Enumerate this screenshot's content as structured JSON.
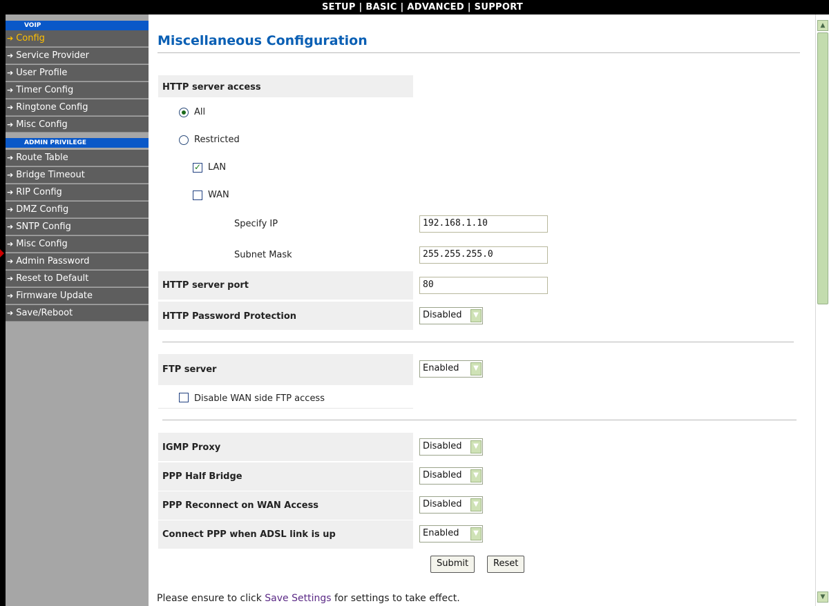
{
  "topnav": {
    "setup": "SETUP",
    "basic": "BASIC",
    "advanced": "ADVANCED",
    "support": "SUPPORT",
    "sep": "|"
  },
  "sidebar": {
    "voip_header": "VOIP",
    "voip_items": [
      {
        "label": "Config"
      },
      {
        "label": "Service Provider"
      },
      {
        "label": "User Profile"
      },
      {
        "label": "Timer Config"
      },
      {
        "label": "Ringtone Config"
      },
      {
        "label": "Misc Config"
      }
    ],
    "admin_header": "ADMIN PRIVILEGE",
    "admin_items": [
      {
        "label": "Route Table"
      },
      {
        "label": "Bridge Timeout"
      },
      {
        "label": "RIP Config"
      },
      {
        "label": "DMZ Config"
      },
      {
        "label": "SNTP Config"
      },
      {
        "label": "Misc Config"
      },
      {
        "label": "Admin Password"
      },
      {
        "label": "Reset to Default"
      },
      {
        "label": "Firmware Update"
      },
      {
        "label": "Save/Reboot"
      }
    ],
    "arrow": "➔"
  },
  "main": {
    "title": "Miscellaneous Configuration",
    "http_access": {
      "label": "HTTP server access",
      "opt_all": "All",
      "opt_restricted": "Restricted",
      "lan": "LAN",
      "wan": "WAN",
      "specify_ip_label": "Specify IP",
      "specify_ip_value": "192.168.1.10",
      "subnet_label": "Subnet Mask",
      "subnet_value": "255.255.255.0"
    },
    "http_port": {
      "label": "HTTP server port",
      "value": "80"
    },
    "http_pw": {
      "label": "HTTP Password Protection",
      "value": "Disabled"
    },
    "ftp": {
      "label": "FTP server",
      "value": "Enabled",
      "disable_wan": "Disable WAN side FTP access"
    },
    "igmp": {
      "label": "IGMP Proxy",
      "value": "Disabled"
    },
    "ppp_half": {
      "label": "PPP Half Bridge",
      "value": "Disabled"
    },
    "ppp_reconnect": {
      "label": "PPP Reconnect on WAN Access",
      "value": "Disabled"
    },
    "ppp_adsl": {
      "label": "Connect PPP when ADSL link is up",
      "value": "Enabled"
    },
    "submit": "Submit",
    "reset": "Reset",
    "note_pre": "Please ensure to click ",
    "note_link": "Save Settings",
    "note_post": " for settings to take effect."
  }
}
